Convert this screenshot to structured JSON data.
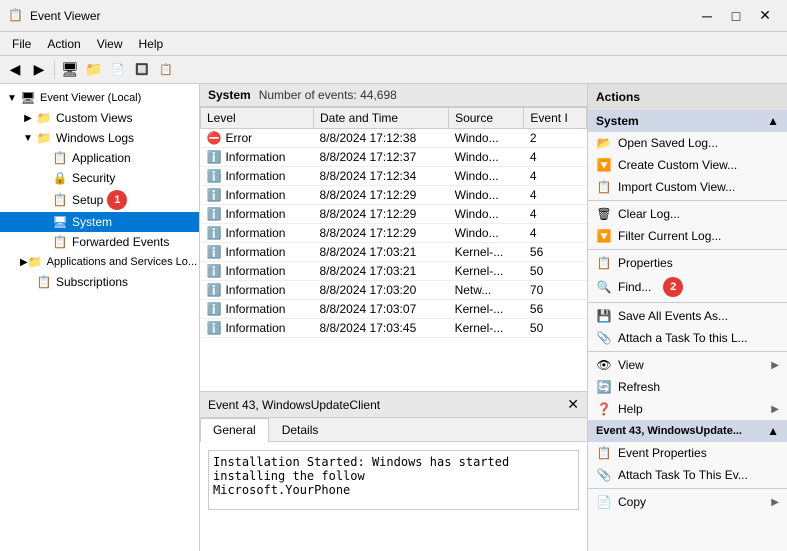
{
  "titleBar": {
    "title": "Event Viewer",
    "icon": "📋"
  },
  "menuBar": {
    "items": [
      "File",
      "Action",
      "View",
      "Help"
    ]
  },
  "toolbar": {
    "buttons": [
      "◀",
      "▶",
      "🖥",
      "📁",
      "🗒",
      "🔍",
      "📋"
    ]
  },
  "tree": {
    "items": [
      {
        "id": "local",
        "label": "Event Viewer (Local)",
        "indent": 0,
        "expanded": true,
        "type": "root"
      },
      {
        "id": "custom",
        "label": "Custom Views",
        "indent": 1,
        "expanded": false,
        "type": "folder"
      },
      {
        "id": "winlogs",
        "label": "Windows Logs",
        "indent": 1,
        "expanded": true,
        "type": "folder"
      },
      {
        "id": "app",
        "label": "Application",
        "indent": 2,
        "type": "log"
      },
      {
        "id": "security",
        "label": "Security",
        "indent": 2,
        "type": "log"
      },
      {
        "id": "setup",
        "label": "Setup",
        "indent": 2,
        "type": "log",
        "annotation": "1"
      },
      {
        "id": "system",
        "label": "System",
        "indent": 2,
        "type": "log",
        "selected": true
      },
      {
        "id": "forwarded",
        "label": "Forwarded Events",
        "indent": 2,
        "type": "log"
      },
      {
        "id": "appservices",
        "label": "Applications and Services Lo...",
        "indent": 1,
        "type": "folder"
      },
      {
        "id": "subscriptions",
        "label": "Subscriptions",
        "indent": 1,
        "type": "log"
      }
    ]
  },
  "logView": {
    "name": "System",
    "eventCount": "Number of events: 44,698",
    "columns": [
      "Level",
      "Date and Time",
      "Source",
      "Event I"
    ],
    "rows": [
      {
        "level": "Error",
        "levelIcon": "🔴",
        "datetime": "8/8/2024 17:12:38",
        "source": "Windo...",
        "eventId": "2"
      },
      {
        "level": "Information",
        "levelIcon": "ℹ",
        "datetime": "8/8/2024 17:12:37",
        "source": "Windo...",
        "eventId": "4"
      },
      {
        "level": "Information",
        "levelIcon": "ℹ",
        "datetime": "8/8/2024 17:12:34",
        "source": "Windo...",
        "eventId": "4"
      },
      {
        "level": "Information",
        "levelIcon": "ℹ",
        "datetime": "8/8/2024 17:12:29",
        "source": "Windo...",
        "eventId": "4"
      },
      {
        "level": "Information",
        "levelIcon": "ℹ",
        "datetime": "8/8/2024 17:12:29",
        "source": "Windo...",
        "eventId": "4"
      },
      {
        "level": "Information",
        "levelIcon": "ℹ",
        "datetime": "8/8/2024 17:12:29",
        "source": "Windo...",
        "eventId": "4"
      },
      {
        "level": "Information",
        "levelIcon": "ℹ",
        "datetime": "8/8/2024 17:03:21",
        "source": "Kernel-...",
        "eventId": "56"
      },
      {
        "level": "Information",
        "levelIcon": "ℹ",
        "datetime": "8/8/2024 17:03:21",
        "source": "Kernel-...",
        "eventId": "50"
      },
      {
        "level": "Information",
        "levelIcon": "ℹ",
        "datetime": "8/8/2024 17:03:20",
        "source": "Netw...",
        "eventId": "70"
      },
      {
        "level": "Information",
        "levelIcon": "ℹ",
        "datetime": "8/8/2024 17:03:07",
        "source": "Kernel-...",
        "eventId": "56"
      },
      {
        "level": "Information",
        "levelIcon": "ℹ",
        "datetime": "8/8/2024 17:03:45",
        "source": "Kernel-...",
        "eventId": "50"
      }
    ]
  },
  "detail": {
    "title": "Event 43, WindowsUpdateClient",
    "closeBtn": "✕",
    "tabs": [
      "General",
      "Details"
    ],
    "activeTab": "General",
    "content": "Installation Started: Windows has started installing the follow\nMicrosoft.YourPhone"
  },
  "actions": {
    "header": "Actions",
    "systemSection": "System",
    "sectionArrow": "▲",
    "items": [
      {
        "id": "open-saved",
        "icon": "📂",
        "label": "Open Saved Log..."
      },
      {
        "id": "create-custom",
        "icon": "🔽",
        "label": "Create Custom View..."
      },
      {
        "id": "import-custom",
        "icon": "📋",
        "label": "Import Custom View..."
      },
      {
        "separator": true
      },
      {
        "id": "clear-log",
        "icon": "🗑",
        "label": "Clear Log..."
      },
      {
        "id": "filter",
        "icon": "🔽",
        "label": "Filter Current Log..."
      },
      {
        "separator": true
      },
      {
        "id": "properties",
        "icon": "📋",
        "label": "Properties"
      },
      {
        "id": "find",
        "icon": "🔍",
        "label": "Find...",
        "annotation": "2"
      },
      {
        "separator": true
      },
      {
        "id": "save-all",
        "icon": "💾",
        "label": "Save All Events As..."
      },
      {
        "id": "attach-task",
        "icon": "📎",
        "label": "Attach a Task To this L..."
      },
      {
        "separator": true
      },
      {
        "id": "view",
        "icon": "👁",
        "label": "View",
        "hasArrow": true
      },
      {
        "id": "refresh",
        "icon": "🔄",
        "label": "Refresh"
      },
      {
        "id": "help",
        "icon": "❓",
        "label": "Help",
        "hasArrow": true
      }
    ],
    "event43Section": "Event 43, WindowsUpdate...",
    "event43Arrow": "▲",
    "event43Items": [
      {
        "id": "event-properties",
        "icon": "📋",
        "label": "Event Properties"
      },
      {
        "id": "attach-task-event",
        "icon": "📎",
        "label": "Attach Task To This Ev..."
      },
      {
        "separator": true
      },
      {
        "id": "copy",
        "icon": "📄",
        "label": "Copy",
        "hasArrow": true
      }
    ]
  }
}
